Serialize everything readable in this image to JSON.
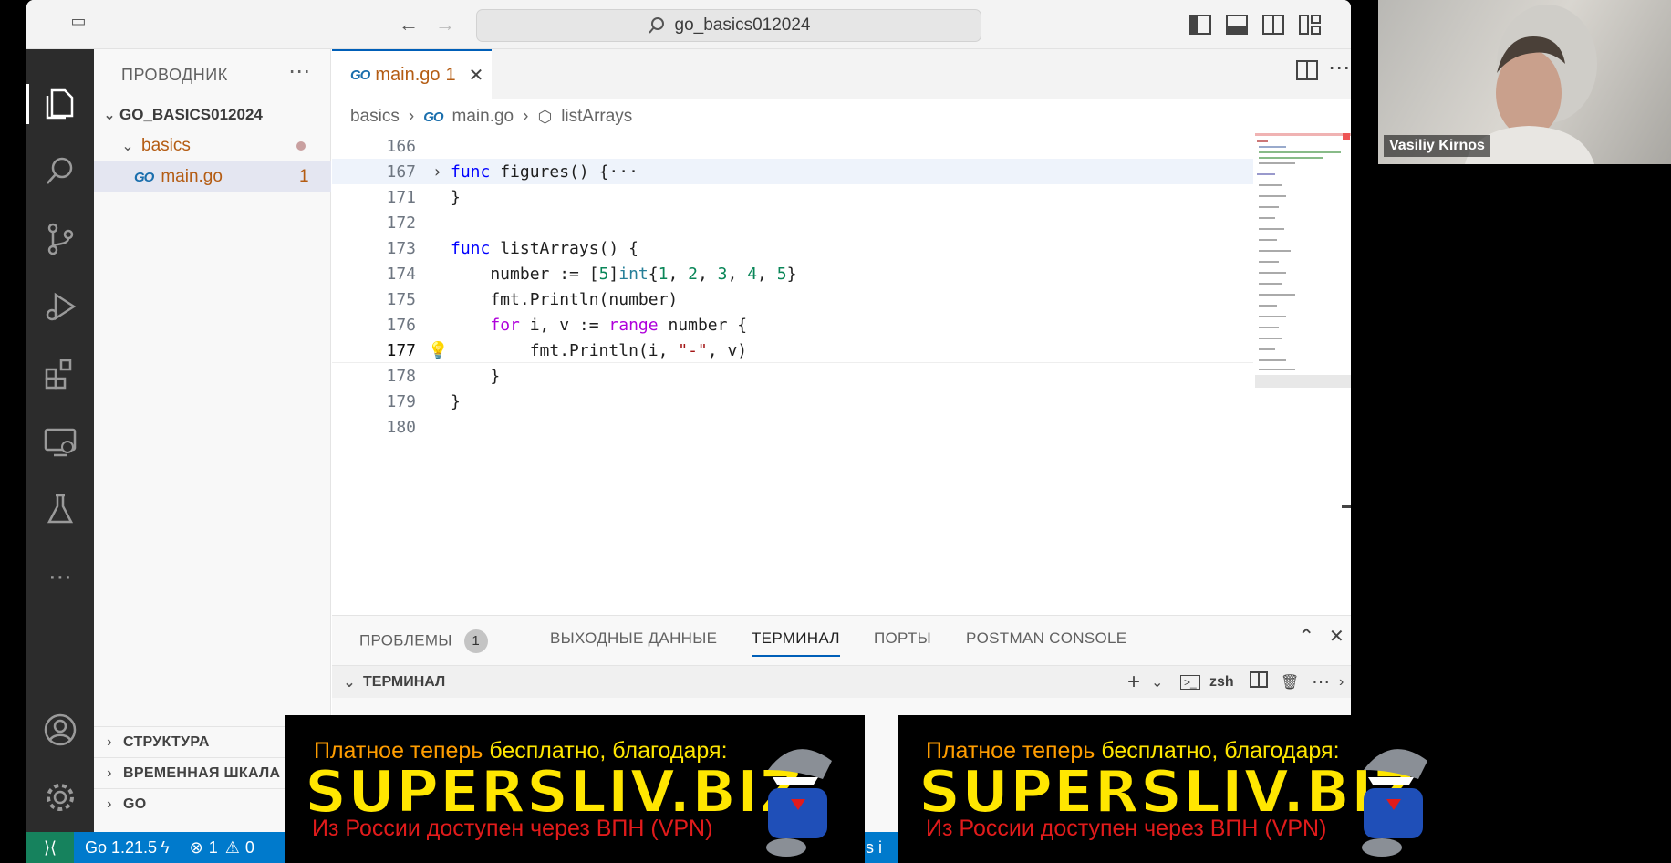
{
  "window": {
    "search_text": "go_basics012024"
  },
  "sidebar": {
    "title": "ПРОВОДНИК",
    "root": "GO_BASICS012024",
    "folder": "basics",
    "file": "main.go",
    "file_problems": "1",
    "sections": [
      "СТРУКТУРА",
      "ВРЕМЕННАЯ ШКАЛА",
      "GO"
    ]
  },
  "editor": {
    "tab_label": "main.go",
    "tab_problems": "1",
    "breadcrumb": [
      "basics",
      "main.go",
      "listArrays"
    ],
    "lines": [
      {
        "n": "166",
        "code": ""
      },
      {
        "n": "167",
        "code": "func figures() {···"
      },
      {
        "n": "171",
        "code": "}"
      },
      {
        "n": "172",
        "code": ""
      },
      {
        "n": "173",
        "code": "func listArrays() {"
      },
      {
        "n": "174",
        "code": "    number := [5]int{1, 2, 3, 4, 5}"
      },
      {
        "n": "175",
        "code": "    fmt.Println(number)"
      },
      {
        "n": "176",
        "code": "    for i, v := range number {"
      },
      {
        "n": "177",
        "code": "        fmt.Println(i, \"-\", v)"
      },
      {
        "n": "178",
        "code": "    }"
      },
      {
        "n": "179",
        "code": "}"
      },
      {
        "n": "180",
        "code": ""
      }
    ]
  },
  "panel": {
    "tabs": [
      "ПРОБЛЕМЫ",
      "ВЫХОДНЫЕ ДАННЫЕ",
      "ТЕРМИНАЛ",
      "ПОРТЫ",
      "POSTMAN CONSOLE"
    ],
    "problems_count": "1",
    "terminal_title": "ТЕРМИНАЛ",
    "shell": "zsh"
  },
  "statusbar": {
    "go_version": "Go 1.21.5",
    "errors": "1",
    "warnings": "0",
    "right_fragment": "s i"
  },
  "webcam": {
    "name": "Vasiliy Kirnos"
  },
  "banner": {
    "line1_a": "Платное теперь",
    "line1_b": "бесплатно, благодаря:",
    "big": "SUPERSLIV.BIZ",
    "line3": "Из России доступен через ВПН (VPN)"
  },
  "colors": {
    "accent": "#007acc",
    "activity_bar": "#2c2c2c",
    "banner_yellow": "#ffe600",
    "banner_red": "#e11b1b"
  }
}
